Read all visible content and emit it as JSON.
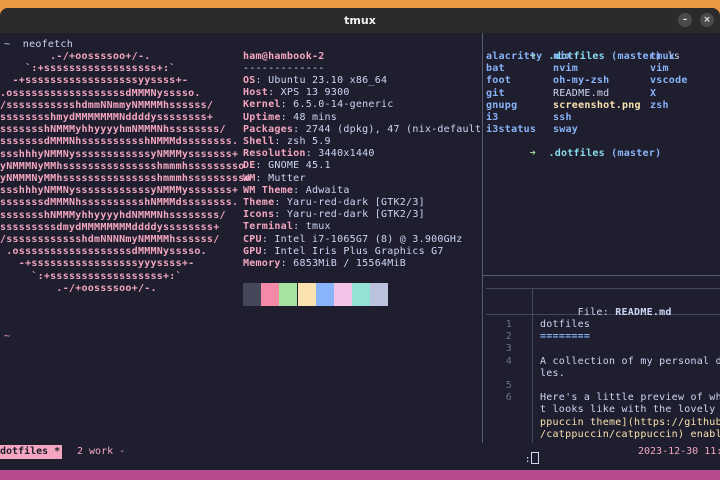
{
  "window": {
    "title": "tmux"
  },
  "colors": {
    "background": "#1e1e2e",
    "accent_pink": "#f4a6c0",
    "text": "#cdd6f4",
    "blue": "#89b4fa",
    "status_bar": "#b84a8e",
    "desktop": "#e99a42"
  },
  "left_pane": {
    "prompt": "~  neofetch",
    "ascii_art": [
      "        .-/+oossssoo+/-.",
      "    `:+ssssssssssssssssss+:`",
      "  -+ssssssssssssssssssyyssss+-",
      ".ossssssssssssssssssdMMMNysssso.",
      "/ssssssssssshdmmNNmmyNMMMMhssssss/",
      "sssssssshmydMMMMMMMNddddyssssssss+",
      "ssssssshNMMMyhhyyyyhmNMMMNhssssssss/",
      "sssssssdMMMNhsssssssssshNMMMdssssssss.",
      "ssshhhyNMMNyssssssssssssyNMMMysssssss+",
      "yNMMMNyMMhssssssssssssssshmmmhsssssssso",
      "yNMMMNyMMhssssssssssssssshmmmhssssssssso",
      "ssshhhyNMMNyssssssssssssyNMMMysssssss+",
      "sssssssdMMMNhsssssssssshNMMMdssssssss.",
      "ssssssshNMMMyhhyyyyhdNMMMNhssssssss/",
      "sssssssssdmydMMMMMMMMddddyssssssss+",
      "/sssssssssssshdmNNNNmyNMMMMhssssss/",
      " .ossssssssssssssssssdMMMNysssso.",
      "   -+sssssssssssssssssyyyssss+-",
      "     `:+ssssssssssssssssss+:`",
      "         .-/+oossssoo+/-."
    ],
    "user_host": "ham@hambook-2",
    "separator": "-------------",
    "info": [
      {
        "key": "OS",
        "value": "Ubuntu 23.10 x86_64"
      },
      {
        "key": "Host",
        "value": "XPS 13 9300"
      },
      {
        "key": "Kernel",
        "value": "6.5.0-14-generic"
      },
      {
        "key": "Uptime",
        "value": "48 mins"
      },
      {
        "key": "Packages",
        "value": "2744 (dpkg), 47 (nix-default"
      },
      {
        "key": "Shell",
        "value": "zsh 5.9"
      },
      {
        "key": "Resolution",
        "value": "3440x1440"
      },
      {
        "key": "DE",
        "value": "GNOME 45.1"
      },
      {
        "key": "WM",
        "value": "Mutter"
      },
      {
        "key": "WM Theme",
        "value": "Adwaita"
      },
      {
        "key": "Theme",
        "value": "Yaru-red-dark [GTK2/3]"
      },
      {
        "key": "Icons",
        "value": "Yaru-red-dark [GTK2/3]"
      },
      {
        "key": "Terminal",
        "value": "tmux"
      },
      {
        "key": "CPU",
        "value": "Intel i7-1065G7 (8) @ 3.900GHz"
      },
      {
        "key": "GPU",
        "value": "Intel Iris Plus Graphics G7"
      },
      {
        "key": "Memory",
        "value": "6853MiB / 15564MiB"
      }
    ],
    "palette": [
      "#45475a",
      "#f38ba8",
      "#a6e3a1",
      "#f9e2af",
      "#89b4fa",
      "#f5c2e7",
      "#94e2d5",
      "#bac2de"
    ],
    "idle_prompt": "~"
  },
  "right_top_pane": {
    "prompt_arrow": "➜",
    "prompt_dir": ".dotfiles",
    "prompt_branch": "(master)",
    "command": "ls",
    "files": {
      "col1": [
        "alacritty",
        "bat",
        "foot",
        "git",
        "gnupg",
        "i3",
        "i3status"
      ],
      "col2": [
        "nix",
        "nvim",
        "oh-my-zsh",
        "README.md",
        "screenshot.png",
        "ssh",
        "sway"
      ],
      "col3": [
        "tmux",
        "vim",
        "vscode",
        "X",
        "zsh"
      ]
    }
  },
  "right_bottom_pane": {
    "file_label": "File: ",
    "file_name": "README.md",
    "line_numbers": [
      "1",
      "2",
      "3",
      "4",
      "",
      "5",
      "6",
      "",
      ""
    ],
    "lines": [
      "dotfiles",
      "========",
      "",
      "A collection of my personal do",
      "les.",
      "",
      "Here's a little preview of wha",
      "t looks like with the lovely [",
      "ppuccin theme](https://github.",
      "/catppuccin/catppuccin) enable"
    ],
    "command_prompt": ":"
  },
  "status_bar": {
    "active_tab": "dotfiles *",
    "tab2": "2 work -",
    "datetime": "2023-12-30 11:"
  }
}
